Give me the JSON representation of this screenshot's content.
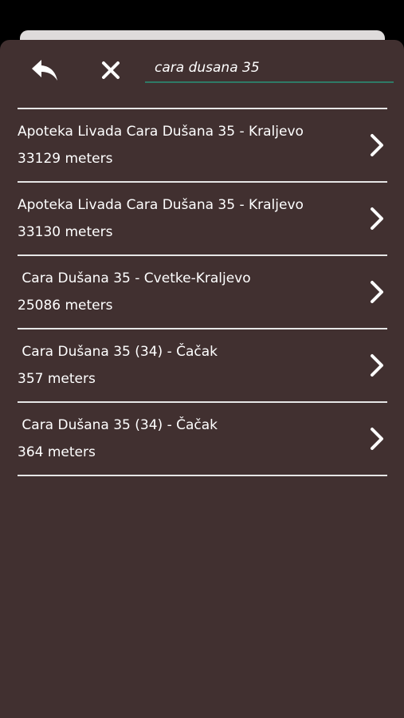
{
  "search": {
    "value": "cara dusana 35"
  },
  "results": [
    {
      "title": "Apoteka Livada Cara Dušana 35 - Kraljevo",
      "distance": "33129 meters"
    },
    {
      "title": "Apoteka Livada Cara Dušana 35 - Kraljevo",
      "distance": "33130 meters"
    },
    {
      "title": " Cara Dušana 35 - Cvetke-Kraljevo",
      "distance": "25086 meters"
    },
    {
      "title": " Cara Dušana 35 (34) - Čačak",
      "distance": "357 meters"
    },
    {
      "title": " Cara Dušana 35 (34) - Čačak",
      "distance": "364 meters"
    }
  ],
  "icons": {
    "back": "back-arrow-icon",
    "clear": "close-icon",
    "row_chevron": "chevron-right-icon"
  },
  "colors": {
    "sheet_background": "#413030",
    "accent_underline": "#2f7a66",
    "text": "#ffffff",
    "divider": "#e6e6e6"
  }
}
